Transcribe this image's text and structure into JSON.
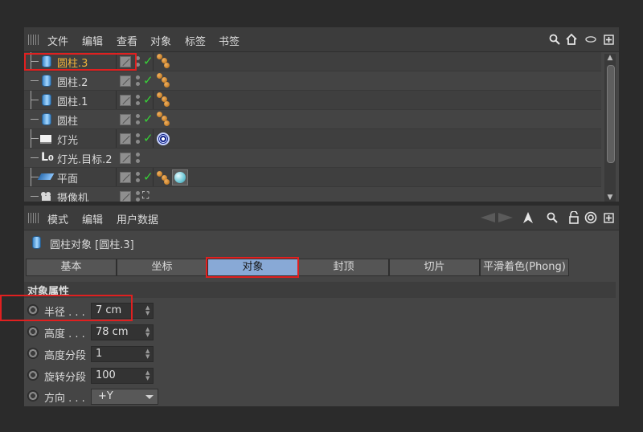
{
  "object_manager": {
    "menu": [
      "文件",
      "编辑",
      "查看",
      "对象",
      "标签",
      "书签"
    ],
    "toolbar_icons": [
      "search-icon",
      "home-icon",
      "hide-icon",
      "new-window-icon"
    ],
    "objects": [
      {
        "name": "圆柱.3",
        "icon": "cylinder-icon",
        "selected": true,
        "tags": [
          "phong-tag"
        ]
      },
      {
        "name": "圆柱.2",
        "icon": "cylinder-icon",
        "tags": [
          "phong-tag"
        ]
      },
      {
        "name": "圆柱.1",
        "icon": "cylinder-icon",
        "tags": [
          "phong-tag"
        ]
      },
      {
        "name": "圆柱",
        "icon": "cylinder-icon",
        "tags": [
          "phong-tag"
        ]
      },
      {
        "name": "灯光",
        "icon": "light-icon",
        "tags": [
          "target-tag"
        ]
      },
      {
        "name": "灯光.目标.2",
        "icon": "null-icon",
        "tags": []
      },
      {
        "name": "平面",
        "icon": "plane-icon",
        "tags": [
          "phong-tag",
          "material-tag"
        ]
      },
      {
        "name": "摄像机",
        "icon": "camera-icon",
        "tags": []
      }
    ]
  },
  "attribute_manager": {
    "menu": [
      "模式",
      "编辑",
      "用户数据"
    ],
    "object_title": "圆柱对象 [圆柱.3]",
    "tabs": [
      {
        "label": "基本",
        "active": false
      },
      {
        "label": "坐标",
        "active": false
      },
      {
        "label": "对象",
        "active": true
      },
      {
        "label": "封顶",
        "active": false
      },
      {
        "label": "切片",
        "active": false
      },
      {
        "label": "平滑着色(Phong)",
        "active": false
      }
    ],
    "section_title": "对象属性",
    "properties": [
      {
        "label": "半径 . . .",
        "value": "7 cm",
        "type": "number"
      },
      {
        "label": "高度 . . .",
        "value": "78 cm",
        "type": "number"
      },
      {
        "label": "高度分段",
        "value": "1",
        "type": "number"
      },
      {
        "label": "旋转分段",
        "value": "100",
        "type": "number"
      },
      {
        "label": "方向 . . .",
        "value": "+Y",
        "type": "dropdown"
      }
    ]
  },
  "colors": {
    "highlight": "#e02020",
    "selected_text": "#f0b43c",
    "active_tab": "#88a9d6",
    "check": "#37d137"
  }
}
